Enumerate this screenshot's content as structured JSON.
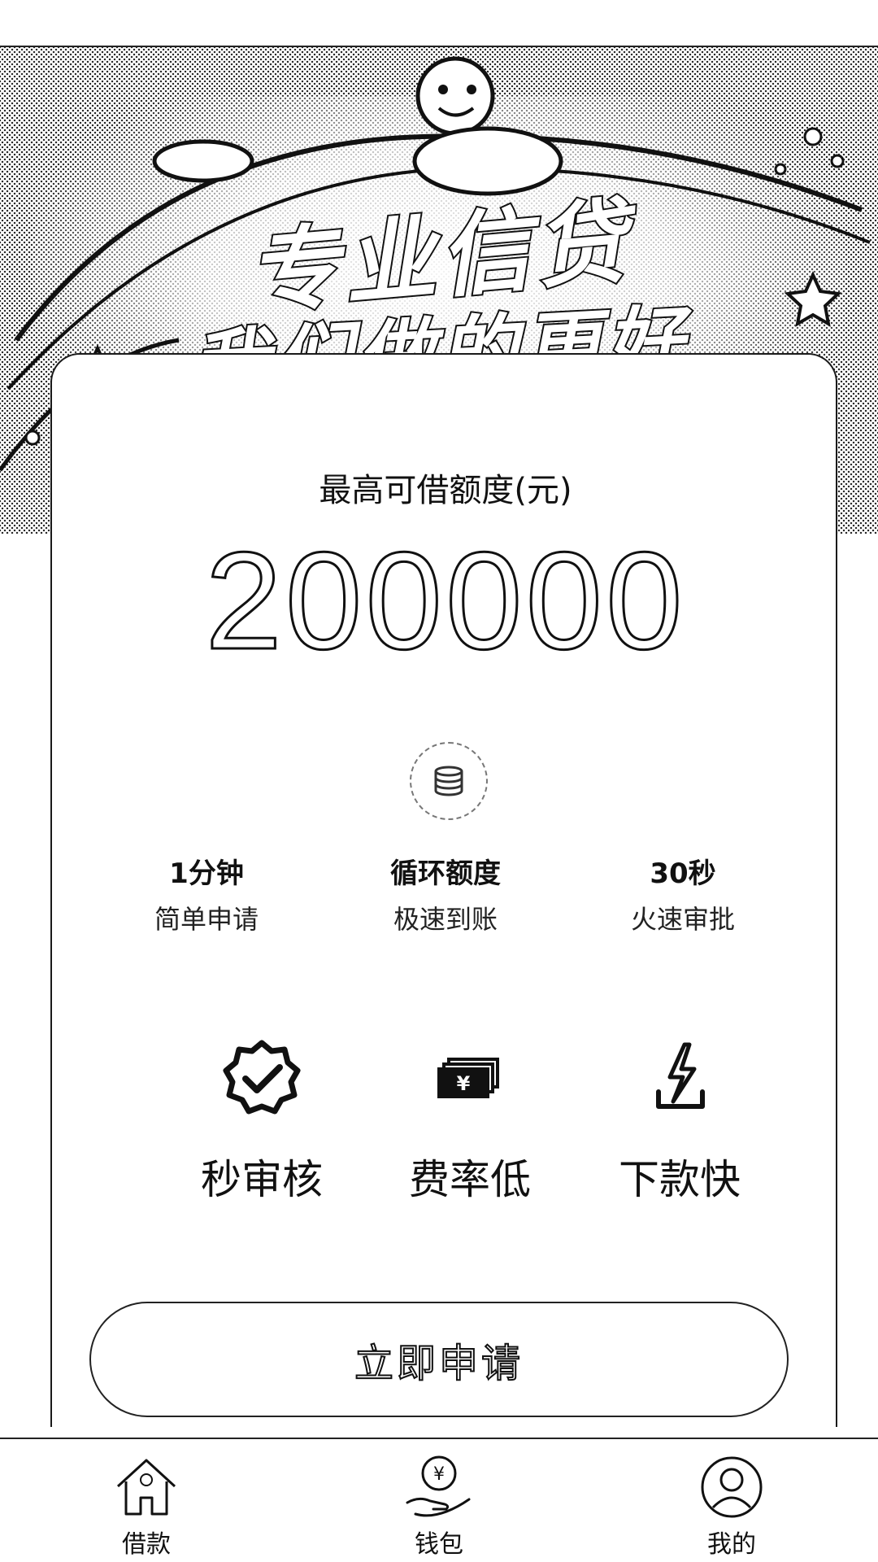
{
  "banner": {
    "slogan_line1": "专业信贷",
    "slogan_line2": "我们做的更好"
  },
  "quota": {
    "label": "最高可借额度(元)",
    "amount": "200000"
  },
  "features": [
    {
      "title": "1分钟",
      "subtitle": "简单申请"
    },
    {
      "title": "循环额度",
      "subtitle": "极速到账"
    },
    {
      "title": "30秒",
      "subtitle": "火速审批"
    }
  ],
  "highlights": [
    {
      "label": "秒审核",
      "icon": "verified-badge-icon"
    },
    {
      "label": "费率低",
      "icon": "yuan-banknote-icon"
    },
    {
      "label": "下款快",
      "icon": "lightning-tray-icon"
    }
  ],
  "apply_button": {
    "label": "立即申请"
  },
  "tabbar": {
    "items": [
      {
        "label": "借款",
        "icon": "home-icon"
      },
      {
        "label": "钱包",
        "icon": "wallet-hand-icon"
      },
      {
        "label": "我的",
        "icon": "user-icon"
      }
    ]
  }
}
